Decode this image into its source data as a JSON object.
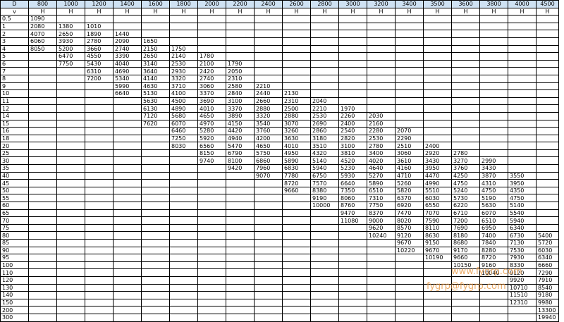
{
  "table": {
    "corner": "D",
    "diameters": [
      "800",
      "1000",
      "1200",
      "1400",
      "1600",
      "1800",
      "2000",
      "2200",
      "2400",
      "2600",
      "2800",
      "3000",
      "3200",
      "3400",
      "3500",
      "3600",
      "3800",
      "4000",
      "4500"
    ],
    "subheader_corner": "v",
    "subheader_unit": "H",
    "rows": [
      {
        "v": "0.5",
        "cells": [
          "1090",
          "",
          "",
          "",
          "",
          "",
          "",
          "",
          "",
          "",
          "",
          "",
          "",
          "",
          "",
          "",
          "",
          "",
          ""
        ]
      },
      {
        "v": "1",
        "cells": [
          "2080",
          "1380",
          "1010",
          "",
          "",
          "",
          "",
          "",
          "",
          "",
          "",
          "",
          "",
          "",
          "",
          "",
          "",
          "",
          ""
        ]
      },
      {
        "v": "2",
        "cells": [
          "4070",
          "2650",
          "1890",
          "1440",
          "",
          "",
          "",
          "",
          "",
          "",
          "",
          "",
          "",
          "",
          "",
          "",
          "",
          "",
          ""
        ]
      },
      {
        "v": "3",
        "cells": [
          "6060",
          "3930",
          "2780",
          "2090",
          "1650",
          "",
          "",
          "",
          "",
          "",
          "",
          "",
          "",
          "",
          "",
          "",
          "",
          "",
          ""
        ]
      },
      {
        "v": "4",
        "cells": [
          "8050",
          "5200",
          "3660",
          "2740",
          "2150",
          "1750",
          "",
          "",
          "",
          "",
          "",
          "",
          "",
          "",
          "",
          "",
          "",
          "",
          ""
        ]
      },
      {
        "v": "5",
        "cells": [
          "",
          "6470",
          "4550",
          "3390",
          "2650",
          "2140",
          "1780",
          "",
          "",
          "",
          "",
          "",
          "",
          "",
          "",
          "",
          "",
          "",
          ""
        ]
      },
      {
        "v": "6",
        "cells": [
          "",
          "7750",
          "5430",
          "4040",
          "3140",
          "2530",
          "2100",
          "1790",
          "",
          "",
          "",
          "",
          "",
          "",
          "",
          "",
          "",
          "",
          ""
        ]
      },
      {
        "v": "7",
        "cells": [
          "",
          "",
          "6310",
          "4690",
          "3640",
          "2930",
          "2420",
          "2050",
          "",
          "",
          "",
          "",
          "",
          "",
          "",
          "",
          "",
          "",
          ""
        ]
      },
      {
        "v": "8",
        "cells": [
          "",
          "",
          "7200",
          "5340",
          "4140",
          "3320",
          "2740",
          "2310",
          "",
          "",
          "",
          "",
          "",
          "",
          "",
          "",
          "",
          "",
          ""
        ]
      },
      {
        "v": "9",
        "cells": [
          "",
          "",
          "",
          "5990",
          "4630",
          "3710",
          "3060",
          "2580",
          "2210",
          "",
          "",
          "",
          "",
          "",
          "",
          "",
          "",
          "",
          ""
        ]
      },
      {
        "v": "10",
        "cells": [
          "",
          "",
          "",
          "6640",
          "5130",
          "4100",
          "3370",
          "2840",
          "2440",
          "2130",
          "",
          "",
          "",
          "",
          "",
          "",
          "",
          "",
          ""
        ]
      },
      {
        "v": "11",
        "cells": [
          "",
          "",
          "",
          "",
          "5630",
          "4500",
          "3690",
          "3100",
          "2660",
          "2310",
          "2040",
          "",
          "",
          "",
          "",
          "",
          "",
          "",
          ""
        ]
      },
      {
        "v": "12",
        "cells": [
          "",
          "",
          "",
          "",
          "6130",
          "4890",
          "4010",
          "3370",
          "2880",
          "2500",
          "2210",
          "1970",
          "",
          "",
          "",
          "",
          "",
          "",
          ""
        ]
      },
      {
        "v": "14",
        "cells": [
          "",
          "",
          "",
          "",
          "7120",
          "5680",
          "4650",
          "3890",
          "3320",
          "2880",
          "2530",
          "2260",
          "2030",
          "",
          "",
          "",
          "",
          "",
          ""
        ]
      },
      {
        "v": "15",
        "cells": [
          "",
          "",
          "",
          "",
          "7620",
          "6070",
          "4970",
          "4150",
          "3540",
          "3070",
          "2690",
          "2400",
          "2160",
          "",
          "",
          "",
          "",
          "",
          ""
        ]
      },
      {
        "v": "16",
        "cells": [
          "",
          "",
          "",
          "",
          "",
          "6460",
          "5280",
          "4420",
          "3760",
          "3260",
          "2860",
          "2540",
          "2280",
          "2070",
          "",
          "",
          "",
          "",
          ""
        ]
      },
      {
        "v": "18",
        "cells": [
          "",
          "",
          "",
          "",
          "",
          "7250",
          "5920",
          "4940",
          "4200",
          "3630",
          "3180",
          "2820",
          "2530",
          "2290",
          "",
          "",
          "",
          "",
          ""
        ]
      },
      {
        "v": "20",
        "cells": [
          "",
          "",
          "",
          "",
          "",
          "8030",
          "6560",
          "5470",
          "4650",
          "4010",
          "3510",
          "3100",
          "2780",
          "2510",
          "2400",
          "",
          "",
          "",
          ""
        ]
      },
      {
        "v": "25",
        "cells": [
          "",
          "",
          "",
          "",
          "",
          "",
          "8150",
          "6790",
          "5750",
          "4950",
          "4320",
          "3810",
          "3400",
          "3060",
          "2920",
          "2780",
          "",
          "",
          ""
        ]
      },
      {
        "v": "30",
        "cells": [
          "",
          "",
          "",
          "",
          "",
          "",
          "9740",
          "8100",
          "6860",
          "5890",
          "5140",
          "4520",
          "4020",
          "3610",
          "3430",
          "3270",
          "2990",
          "",
          ""
        ]
      },
      {
        "v": "35",
        "cells": [
          "",
          "",
          "",
          "",
          "",
          "",
          "",
          "9420",
          "7960",
          "6830",
          "5940",
          "5230",
          "4640",
          "4160",
          "3950",
          "3760",
          "3430",
          "",
          ""
        ]
      },
      {
        "v": "40",
        "cells": [
          "",
          "",
          "",
          "",
          "",
          "",
          "",
          "",
          "9070",
          "7780",
          "6750",
          "5930",
          "5270",
          "4710",
          "4470",
          "4250",
          "3870",
          "3550",
          ""
        ]
      },
      {
        "v": "45",
        "cells": [
          "",
          "",
          "",
          "",
          "",
          "",
          "",
          "",
          "",
          "8720",
          "7570",
          "6640",
          "5890",
          "5260",
          "4990",
          "4750",
          "4310",
          "3950",
          ""
        ]
      },
      {
        "v": "50",
        "cells": [
          "",
          "",
          "",
          "",
          "",
          "",
          "",
          "",
          "",
          "9660",
          "8380",
          "7350",
          "6510",
          "5820",
          "5510",
          "5240",
          "4750",
          "4350",
          ""
        ]
      },
      {
        "v": "55",
        "cells": [
          "",
          "",
          "",
          "",
          "",
          "",
          "",
          "",
          "",
          "",
          "9190",
          "8060",
          "7310",
          "6370",
          "6030",
          "5730",
          "5190",
          "4750",
          ""
        ]
      },
      {
        "v": "60",
        "cells": [
          "",
          "",
          "",
          "",
          "",
          "",
          "",
          "",
          "",
          "",
          "10000",
          "8760",
          "7750",
          "6920",
          "6550",
          "6220",
          "5630",
          "5140",
          ""
        ]
      },
      {
        "v": "65",
        "cells": [
          "",
          "",
          "",
          "",
          "",
          "",
          "",
          "",
          "",
          "",
          "",
          "9470",
          "8370",
          "7470",
          "7070",
          "6710",
          "6070",
          "5540",
          ""
        ]
      },
      {
        "v": "70",
        "cells": [
          "",
          "",
          "",
          "",
          "",
          "",
          "",
          "",
          "",
          "",
          "",
          "11080",
          "9000",
          "8020",
          "7590",
          "7200",
          "6510",
          "5940",
          ""
        ]
      },
      {
        "v": "75",
        "cells": [
          "",
          "",
          "",
          "",
          "",
          "",
          "",
          "",
          "",
          "",
          "",
          "",
          "9620",
          "8570",
          "8110",
          "7690",
          "6950",
          "6340",
          ""
        ]
      },
      {
        "v": "80",
        "cells": [
          "",
          "",
          "",
          "",
          "",
          "",
          "",
          "",
          "",
          "",
          "",
          "",
          "10240",
          "9120",
          "8630",
          "8180",
          "7400",
          "6730",
          "5400"
        ]
      },
      {
        "v": "85",
        "cells": [
          "",
          "",
          "",
          "",
          "",
          "",
          "",
          "",
          "",
          "",
          "",
          "",
          "",
          "9670",
          "9150",
          "8680",
          "7840",
          "7130",
          "5720"
        ]
      },
      {
        "v": "90",
        "cells": [
          "",
          "",
          "",
          "",
          "",
          "",
          "",
          "",
          "",
          "",
          "",
          "",
          "",
          "10220",
          "9670",
          "9170",
          "8280",
          "7530",
          "6030"
        ]
      },
      {
        "v": "95",
        "cells": [
          "",
          "",
          "",
          "",
          "",
          "",
          "",
          "",
          "",
          "",
          "",
          "",
          "",
          "",
          "10190",
          "9660",
          "8720",
          "7930",
          "6340"
        ]
      },
      {
        "v": "100",
        "cells": [
          "",
          "",
          "",
          "",
          "",
          "",
          "",
          "",
          "",
          "",
          "",
          "",
          "",
          "",
          "",
          "10150",
          "9160",
          "8330",
          "6660"
        ]
      },
      {
        "v": "110",
        "cells": [
          "",
          "",
          "",
          "",
          "",
          "",
          "",
          "",
          "",
          "",
          "",
          "",
          "",
          "",
          "",
          "",
          "10040",
          "9120",
          "7290"
        ]
      },
      {
        "v": "120",
        "cells": [
          "",
          "",
          "",
          "",
          "",
          "",
          "",
          "",
          "",
          "",
          "",
          "",
          "",
          "",
          "",
          "",
          "",
          "9920",
          "7910"
        ]
      },
      {
        "v": "130",
        "cells": [
          "",
          "",
          "",
          "",
          "",
          "",
          "",
          "",
          "",
          "",
          "",
          "",
          "",
          "",
          "",
          "",
          "",
          "10710",
          "8540"
        ]
      },
      {
        "v": "140",
        "cells": [
          "",
          "",
          "",
          "",
          "",
          "",
          "",
          "",
          "",
          "",
          "",
          "",
          "",
          "",
          "",
          "",
          "",
          "11510",
          "9180"
        ]
      },
      {
        "v": "150",
        "cells": [
          "",
          "",
          "",
          "",
          "",
          "",
          "",
          "",
          "",
          "",
          "",
          "",
          "",
          "",
          "",
          "",
          "",
          "12310",
          "9980"
        ]
      },
      {
        "v": "200",
        "cells": [
          "",
          "",
          "",
          "",
          "",
          "",
          "",
          "",
          "",
          "",
          "",
          "",
          "",
          "",
          "",
          "",
          "",
          "",
          "13300"
        ]
      },
      {
        "v": "300",
        "cells": [
          "",
          "",
          "",
          "",
          "",
          "",
          "",
          "",
          "",
          "",
          "",
          "",
          "",
          "",
          "",
          "",
          "",
          "",
          "19940"
        ]
      }
    ]
  },
  "watermarks": {
    "upper": "www.fygrp.com",
    "lower": "fygrp@fygrp.com"
  },
  "colors": {
    "header_bg": "#cfe2f3",
    "watermark": "#e69138"
  }
}
